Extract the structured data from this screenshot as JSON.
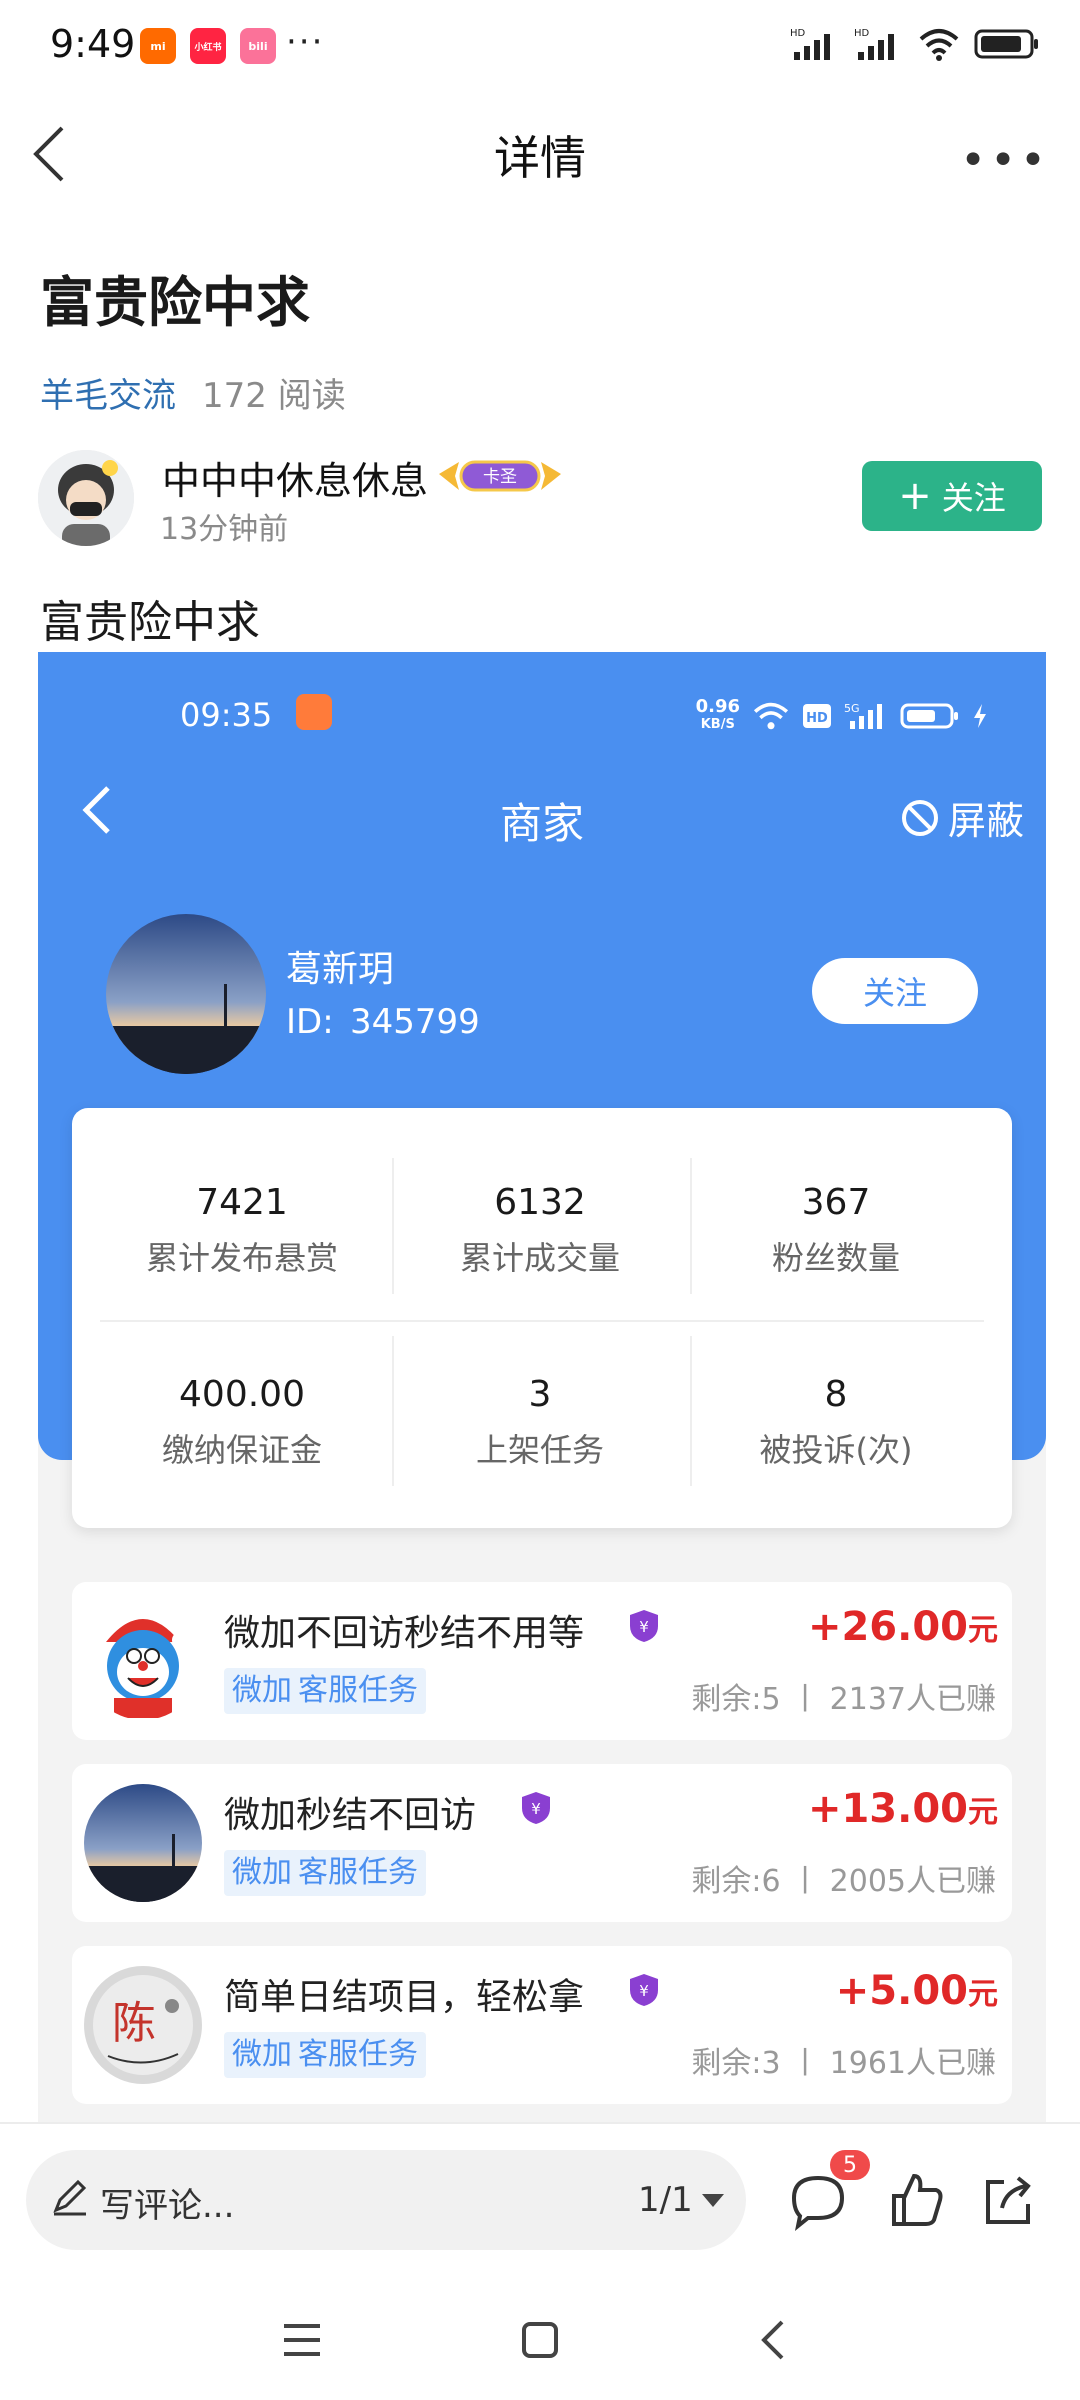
{
  "status_bar": {
    "time": "9:49",
    "apps": [
      {
        "name": "xiaomi-icon",
        "label": "mi",
        "color": "#ff6a00"
      },
      {
        "name": "xiaohongshu-icon",
        "label": "小红书",
        "color": "#ff2442"
      },
      {
        "name": "bilibili-icon",
        "label": "bili",
        "color": "#fb7299"
      }
    ],
    "more": "···"
  },
  "header": {
    "title": "详情"
  },
  "post": {
    "title": "富贵险中求",
    "tag": "羊毛交流",
    "reads": "172 阅读",
    "author": "中中中休息休息",
    "badge": "卡圣",
    "time": "13分钟前",
    "follow_label": "关注",
    "body": "富贵险中求"
  },
  "embedded": {
    "time": "09:35",
    "speed": "0.96",
    "speed_unit": "KB/S",
    "title": "商家",
    "block_label": "屏蔽",
    "merchant_name": "葛新玥",
    "id_label": "ID:",
    "id_value": "345799",
    "follow_label": "关注",
    "stats": [
      {
        "value": "7421",
        "label": "累计发布悬赏"
      },
      {
        "value": "6132",
        "label": "累计成交量"
      },
      {
        "value": "367",
        "label": "粉丝数量"
      },
      {
        "value": "400.00",
        "label": "缴纳保证金"
      },
      {
        "value": "3",
        "label": "上架任务"
      },
      {
        "value": "8",
        "label": "被投诉(次)"
      }
    ],
    "tasks": [
      {
        "title": "微加不回访秒结不用等",
        "chips": [
          "微加",
          "客服任务"
        ],
        "price": "+26.00",
        "unit": "元",
        "stats": "剩余:5 丨 2137人已赚"
      },
      {
        "title": "微加秒结不回访",
        "chips": [
          "微加",
          "客服任务"
        ],
        "price": "+13.00",
        "unit": "元",
        "stats": "剩余:6 丨 2005人已赚"
      },
      {
        "title": "简单日结项目，轻松拿",
        "chips": [
          "微加",
          "客服任务"
        ],
        "price": "+5.00",
        "unit": "元",
        "stats": "剩余:3 丨 1961人已赚"
      }
    ]
  },
  "bottom": {
    "comment_placeholder": "写评论...",
    "page": "1/1",
    "comment_count": "5"
  },
  "colors": {
    "accent_green": "#2cb389",
    "merchant_blue": "#4a8ff0",
    "price_red": "#e02828",
    "link_blue": "#2f6fb1"
  }
}
